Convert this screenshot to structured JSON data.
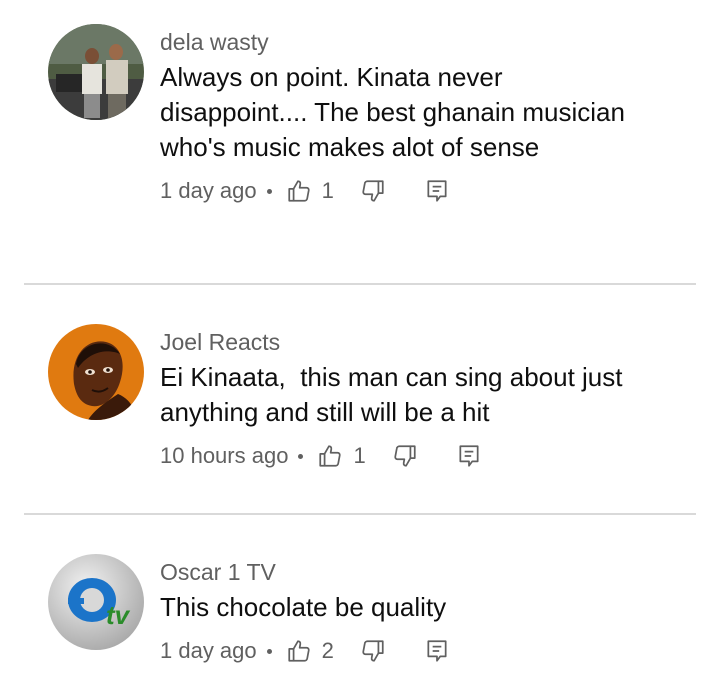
{
  "comments": [
    {
      "author": "dela wasty",
      "text": "Always on point. Kinata never disappoint.... The best ghanain musician who's music makes alot of sense",
      "time": "1 day ago",
      "likes": "1"
    },
    {
      "author": "Joel Reacts",
      "text": "Ei Kinaata,  this man can sing about just anything and still will be a hit",
      "time": "10 hours ago",
      "likes": "1"
    },
    {
      "author": "Oscar 1 TV",
      "text": "This chocolate be quality",
      "time": "1 day ago",
      "likes": "2"
    }
  ],
  "avatars": [
    {
      "name": "photo-avatar",
      "colors": [
        "#5a6a4a",
        "#d9d4c9",
        "#2f2f2f"
      ]
    },
    {
      "name": "illustrated-avatar",
      "colors": [
        "#e07a10",
        "#5a2a10",
        "#1f0f08"
      ]
    },
    {
      "name": "logo-avatar",
      "colors": [
        "#c9c9c9",
        "#1b74c9",
        "#2a8c2a"
      ],
      "logo_text": "tv"
    }
  ],
  "icon_color": "#606060"
}
